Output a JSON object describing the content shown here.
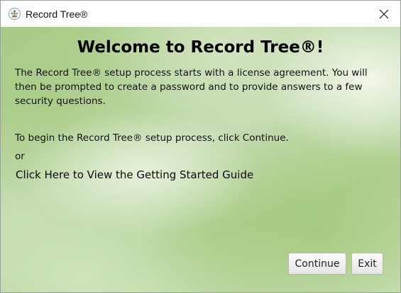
{
  "window": {
    "title": "Record Tree®",
    "app_icon": "tree-icon",
    "close_icon": "close-icon"
  },
  "main": {
    "heading": "Welcome to Record Tree®!",
    "intro": "The Record Tree® setup process starts with a license agreement. You will then be prompted to create a password and to provide answers to a few security questions.",
    "begin_text": "To begin the Record Tree® setup process, click Continue.",
    "or_text": "or",
    "guide_link": "Click Here to View the Getting Started Guide"
  },
  "buttons": {
    "continue_label": "Continue",
    "exit_label": "Exit"
  },
  "colors": {
    "background_green": "#b2d296",
    "heading_text": "#000000"
  }
}
